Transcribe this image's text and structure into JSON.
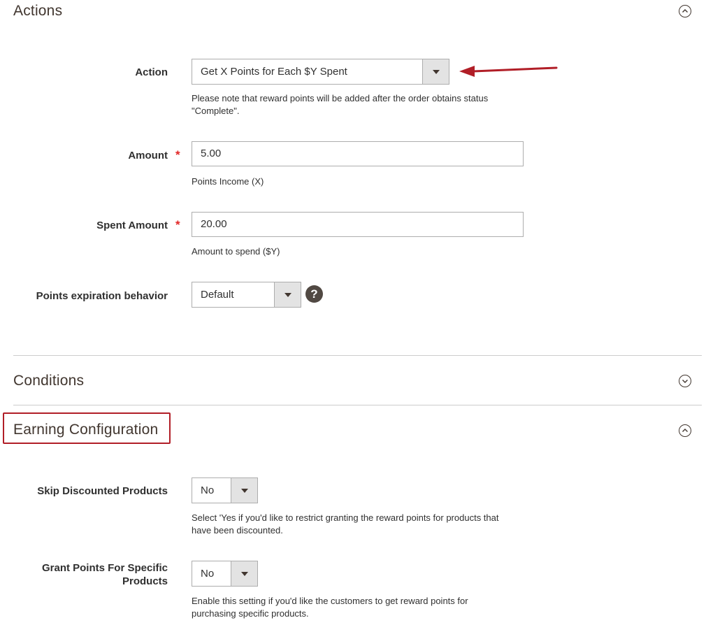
{
  "sections": {
    "actions": {
      "title": "Actions",
      "state": "expanded"
    },
    "conditions": {
      "title": "Conditions",
      "state": "collapsed"
    },
    "earning": {
      "title": "Earning Configuration",
      "state": "expanded"
    }
  },
  "actions_form": {
    "action": {
      "label": "Action",
      "value": "Get X Points for Each $Y Spent",
      "note": "Please note that reward points will be added after the order obtains status \"Complete\"."
    },
    "amount": {
      "label": "Amount",
      "required_mark": "*",
      "value": "5.00",
      "note": "Points Income (X)"
    },
    "spent_amount": {
      "label": "Spent Amount",
      "required_mark": "*",
      "value": "20.00",
      "note": "Amount to spend ($Y)"
    },
    "expiration": {
      "label": "Points expiration behavior",
      "value": "Default",
      "help_icon": "?"
    }
  },
  "earning_form": {
    "skip_discounted": {
      "label": "Skip Discounted Products",
      "value": "No",
      "note": "Select 'Yes if you'd like to restrict granting the reward points for products that have been discounted."
    },
    "grant_specific": {
      "label": "Grant Points For Specific Products",
      "value": "No",
      "note": "Enable this setting if you'd like the customers to get reward points for purchasing specific products."
    }
  },
  "colors": {
    "annotation_red": "#b11e27",
    "required_red": "#e22626",
    "heading_brown": "#41362f"
  },
  "icons": {
    "toggle_up": "chevron-up-circle-icon",
    "toggle_down": "chevron-down-circle-icon",
    "help": "question-mark-icon",
    "annotation_arrow": "red-arrow-icon"
  }
}
